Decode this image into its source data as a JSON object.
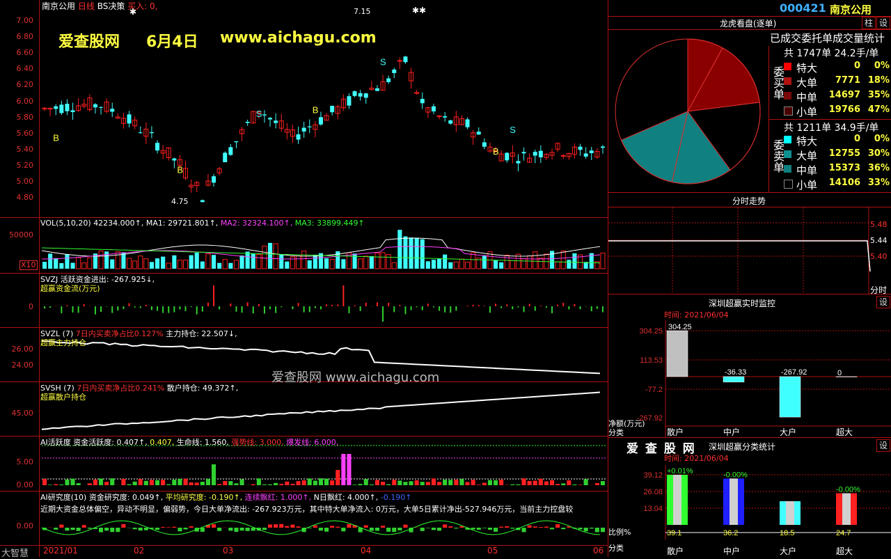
{
  "main": {
    "stock_name": "南京公用",
    "period": "日线",
    "strategy": "BS决策",
    "buy_label": "买入:",
    "buy_value": "0,",
    "watermark": "爱查股网",
    "watermark_date": "6月4日",
    "watermark_url": "www.aichagu.com",
    "high_label": "7.15",
    "low_label": "4.75",
    "price_ticks": [
      "7.00",
      "6.80",
      "6.60",
      "6.40",
      "6.20",
      "6.00",
      "5.80",
      "5.60",
      "5.40",
      "5.20",
      "5.00",
      "4.80"
    ],
    "markers": [
      "B",
      "S",
      "B",
      "S",
      "B",
      "S",
      "B"
    ]
  },
  "vol": {
    "label": "VOL(5,10,20)",
    "value": "42234.000↑,",
    "ma1": "MA1: 29721.801↑,",
    "ma2": "MA2: 32324.100↑,",
    "ma3": "MA3: 33899.449↑",
    "tick": "50000",
    "unit": "X10"
  },
  "svzj": {
    "label": "SVZJ",
    "title": "活跃资金进出: -267.925↓,",
    "sub": "超赢资金流(万元)",
    "tick": "0"
  },
  "svzl": {
    "label": "SVZL (7)",
    "a": "7日内买卖净占比0.127%",
    "b": "主力持仓: 22.507↓,",
    "sub": "超赢主力持仓",
    "ticks": [
      "26.00",
      "24.00"
    ]
  },
  "svsh": {
    "label": "SVSH (7)",
    "a": "7日内买卖净占比0.241%",
    "b": "散户持仓: 49.372↑,",
    "sub": "超赢散户持仓",
    "tick": "45.00",
    "watermark": "爱查股网  www.aichagu.com"
  },
  "ai": {
    "label": "AI活跃度",
    "a": "资金活跃度: 0.407↑,",
    "b": "0.407,",
    "c": "生命线: 1.560,",
    "d": "强势线: 3.000,",
    "e": "爆发线: 6.000,",
    "ticks": [
      "5.00",
      "0.00"
    ]
  },
  "ai2": {
    "label": "AI研究度(10)",
    "a": "资金研究度: 0.049↑,",
    "b": "平均研究度: -0.190↑,",
    "c": "连续飘红: 1.000↑,",
    "d": "N日飘红: 4.000↑,",
    "e": "-0.190↑",
    "comment": "近期大资金总体偏空，异动不明显，偏弱势，今日大单净流出: -267.923万元，其中特大单净流入: 0万元，大单5日累计净出-527.946万元，当前主力控盘较",
    "tick": "0.00"
  },
  "side_label": "大智慧",
  "dates": [
    "2021/01",
    "02",
    "03",
    "04",
    "05",
    "06"
  ],
  "right": {
    "code": "000421",
    "name": "南京公用",
    "btn1": "柱",
    "btn2": "设",
    "pie_title": "龙虎看盘(逐单)",
    "stat_title": "已成交委托单成交量统计",
    "buy_side": "委买单",
    "sell_side": "委卖单",
    "buy_total": "共 1747单 24.2手/单",
    "sell_total": "共 1211单 34.9手/单",
    "buy_rows": [
      {
        "name": "特大",
        "count": "0",
        "pct": "0%"
      },
      {
        "name": "大单",
        "count": "7771",
        "pct": "18%"
      },
      {
        "name": "中单",
        "count": "14697",
        "pct": "35%"
      },
      {
        "name": "小单",
        "count": "19766",
        "pct": "47%"
      }
    ],
    "sell_rows": [
      {
        "name": "特大",
        "count": "0",
        "pct": "0%"
      },
      {
        "name": "大单",
        "count": "12755",
        "pct": "30%"
      },
      {
        "name": "中单",
        "count": "15373",
        "pct": "36%"
      },
      {
        "name": "小单",
        "count": "14106",
        "pct": "33%"
      }
    ],
    "intraday_title": "分时走势",
    "intraday_ticks": [
      "5.48",
      "5.44",
      "5.40"
    ],
    "intraday_extra": "分时",
    "mon_title": "深圳超赢实时监控",
    "mon_btn": "设",
    "mon_time": "时间: 2021/06/04",
    "mon_values": [
      "304.25",
      "-36.33",
      "-267.92",
      "0"
    ],
    "mon_ticks": [
      "304.25",
      "113.53",
      "-77.2",
      "-267.92"
    ],
    "mon_ylabel": "净额(万元)",
    "mon_xlabel": "分类",
    "mon_cats": [
      "散户",
      "中户",
      "大户",
      "超大"
    ],
    "cls_brand": "爱 查 股 网",
    "cls_title": "深圳超赢分类统计",
    "cls_btn": "设",
    "cls_time": "时间: 2021/06/04",
    "cls_top": [
      "+0.01%",
      "-0.00%",
      "",
      "-0.00%"
    ],
    "cls_values": [
      "39.1",
      "36.2",
      "18.5",
      "24.7"
    ],
    "cls_ticks": [
      "39.12",
      "26.08",
      "13.04"
    ],
    "cls_ylabel": "比例%",
    "cls_xlabel": "分类",
    "cls_cats": [
      "散户",
      "中户",
      "大户",
      "超大"
    ]
  },
  "colors": {
    "up": "#ff2020",
    "down": "#40ffff",
    "grid": "#b01010",
    "accent": "#ffff40"
  }
}
